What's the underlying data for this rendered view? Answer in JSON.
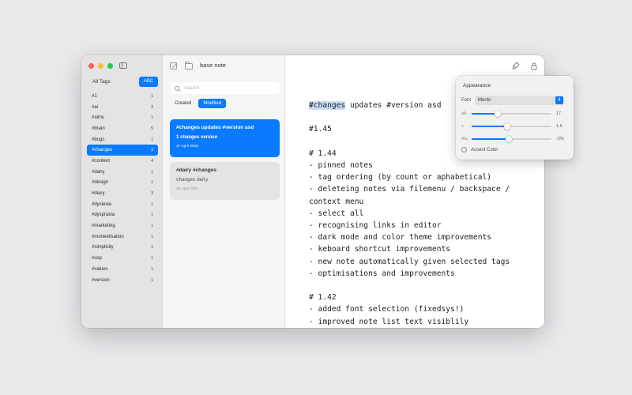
{
  "window": {
    "doc_title": "base note"
  },
  "sidebar": {
    "all_tags_label": "All Tags",
    "sort_button_label": "ABC",
    "tags": [
      {
        "name": "#1",
        "count": "1"
      },
      {
        "name": "#ai",
        "count": "2"
      },
      {
        "name": "#aims",
        "count": "1"
      },
      {
        "name": "#brain",
        "count": "5"
      },
      {
        "name": "#bugs",
        "count": "1"
      },
      {
        "name": "#changes",
        "count": "2",
        "selected": true
      },
      {
        "name": "#content",
        "count": "4"
      },
      {
        "name": "#dairy",
        "count": "1"
      },
      {
        "name": "#design",
        "count": "1"
      },
      {
        "name": "#diary",
        "count": "3"
      },
      {
        "name": "#dyslexia",
        "count": "1"
      },
      {
        "name": "#dyspraxia",
        "count": "1"
      },
      {
        "name": "#marketing",
        "count": "1"
      },
      {
        "name": "#moneetisation",
        "count": "1"
      },
      {
        "name": "#simplicity",
        "count": "1"
      },
      {
        "name": "#usp",
        "count": "1"
      },
      {
        "name": "#values",
        "count": "1"
      },
      {
        "name": "#version",
        "count": "1"
      }
    ]
  },
  "notelist": {
    "search_placeholder": "Search",
    "sort_created": "Created",
    "sort_modified": "Modified",
    "notes": [
      {
        "title": "#changes updates #version asd",
        "preview": "1 changes version",
        "date": "27 April 2025"
      },
      {
        "title": "#dairy #changes",
        "preview": "changes dairy",
        "date": "26 April 2025"
      }
    ]
  },
  "editor": {
    "highlight_word": "#changes",
    "first_line_rest": " updates #version asd",
    "body": "\n\n#1.45\n\n# 1.44\n- pinned notes\n- tag ordering (by count or aphabetical)\n- deleteing notes via filemenu / backspace /\ncontext menu\n- select all\n- recognising links in editor\n- dark mode and color theme improvements\n- keboard shortcut improvements\n- new note automatically given selected tags\n- optimisations and improvements\n\n# 1.42\n- added font selection (fixedsys!)\n- improved note list text visiblily"
  },
  "appearance": {
    "title": "Appearance",
    "font_label": "Font",
    "font_value": "Menlo",
    "sliders": [
      {
        "icon": "aA",
        "value": "17",
        "fraction": 0.33
      },
      {
        "icon": "≡",
        "value": "1.5",
        "fraction": 0.45
      },
      {
        "icon": "Abc",
        "value": "-2%",
        "fraction": 0.47
      }
    ],
    "accent_label": "Accent Color"
  },
  "colors": {
    "accent": "#0a7aff",
    "highlight": "#c9dcf8"
  }
}
